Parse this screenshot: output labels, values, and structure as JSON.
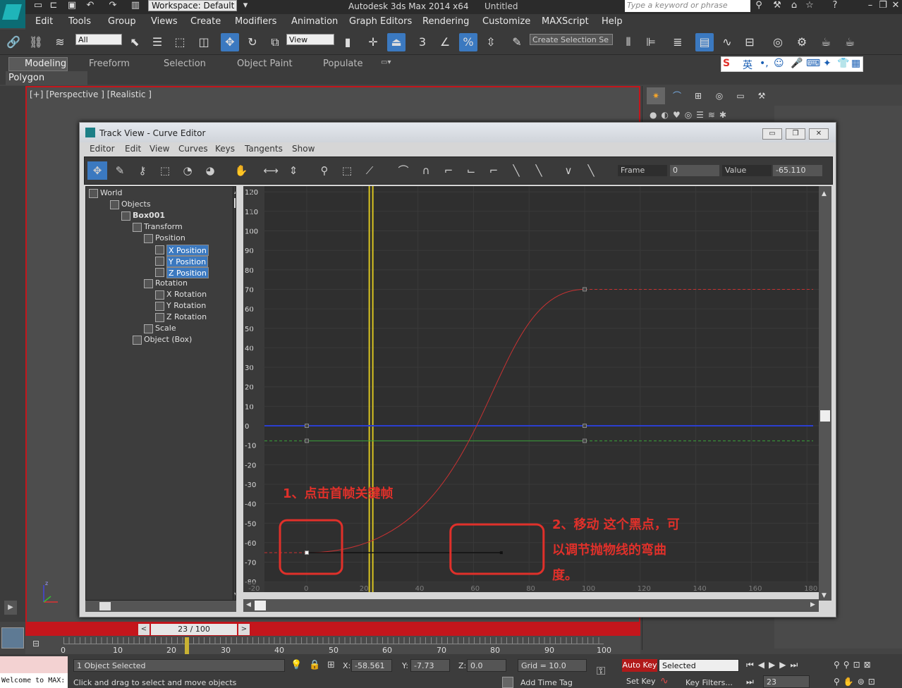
{
  "app": {
    "title": "Autodesk 3ds Max  2014 x64",
    "document": "Untitled",
    "workspace": "Workspace: Default",
    "search_placeholder": "Type a keyword or phrase"
  },
  "menu": [
    "Edit",
    "Tools",
    "Group",
    "Views",
    "Create",
    "Modifiers",
    "Animation",
    "Graph Editors",
    "Rendering",
    "Customize",
    "MAXScript",
    "Help"
  ],
  "toolbar": {
    "filter_value": "All",
    "refcoord_value": "View",
    "selection_set_placeholder": "Create Selection Se"
  },
  "ribbon": {
    "tabs": [
      "Modeling",
      "Freeform",
      "Selection",
      "Object Paint",
      "Populate"
    ],
    "panel": "Polygon Modeling"
  },
  "ime": {
    "lang": "英",
    "punct": "•,"
  },
  "viewport": {
    "label": "[+] [Perspective ] [Realistic ]"
  },
  "curve_editor": {
    "title": "Track View - Curve Editor",
    "menu": [
      "Editor",
      "Edit",
      "View",
      "Curves",
      "Keys",
      "Tangents",
      "Show"
    ],
    "frame_label": "Frame",
    "frame_value": "0",
    "value_label": "Value",
    "value_value": "-65.110",
    "tree": [
      {
        "label": "World",
        "indent": 0
      },
      {
        "label": "Objects",
        "indent": 1
      },
      {
        "label": "Box001",
        "indent": 2
      },
      {
        "label": "Transform",
        "indent": 3
      },
      {
        "label": "Position",
        "indent": 4
      },
      {
        "label": "X Position",
        "indent": 5,
        "selected": true
      },
      {
        "label": "Y Position",
        "indent": 5,
        "selected": true
      },
      {
        "label": "Z Position",
        "indent": 5,
        "selected": true
      },
      {
        "label": "Rotation",
        "indent": 4
      },
      {
        "label": "X Rotation",
        "indent": 5
      },
      {
        "label": "Y Rotation",
        "indent": 5
      },
      {
        "label": "Z Rotation",
        "indent": 5
      },
      {
        "label": "Scale",
        "indent": 4
      },
      {
        "label": "Object (Box)",
        "indent": 3
      }
    ],
    "y_ticks": [
      120,
      110,
      100,
      90,
      80,
      70,
      60,
      50,
      40,
      30,
      20,
      10,
      0,
      -10,
      -20,
      -30,
      -40,
      -50,
      -60,
      -70,
      -80
    ],
    "x_ticks": [
      -20,
      0,
      20,
      40,
      60,
      80,
      100,
      120,
      140,
      160,
      180
    ],
    "current_frame": 23,
    "curves": {
      "x_position": {
        "color": "#c83232",
        "key0": [
          0,
          -65.11
        ],
        "key1": [
          100,
          70
        ],
        "tangent_handle_frame": 70
      },
      "y_position": {
        "color": "#3aa33a",
        "value": -7.73
      },
      "z_position": {
        "color": "#2b3fd0",
        "value": 0
      }
    },
    "annotations": {
      "note1": "1、点击首帧关键帧",
      "note2_line1": "2、移动 这个黑点，可",
      "note2_line2": "以调节抛物线的弯曲",
      "note2_line3": "度。"
    }
  },
  "timeline": {
    "slider_label": "23 / 100",
    "ticks": [
      "0",
      "10",
      "20",
      "30",
      "40",
      "50",
      "60",
      "70",
      "80",
      "90",
      "100"
    ]
  },
  "status": {
    "maxscript": "Welcome to MAX:",
    "selected": "1 Object Selected",
    "prompt": "Click and drag to select and move objects",
    "x_label": "X:",
    "x_value": "-58.561",
    "y_label": "Y:",
    "y_value": "-7.73",
    "z_label": "Z:",
    "z_value": "0.0",
    "grid": "Grid = 10.0",
    "add_time_tag": "Add Time Tag",
    "auto_key": "Auto Key",
    "set_key": "Set Key",
    "key_mode": "Selected",
    "key_filters": "Key Filters...",
    "frame": "23"
  }
}
